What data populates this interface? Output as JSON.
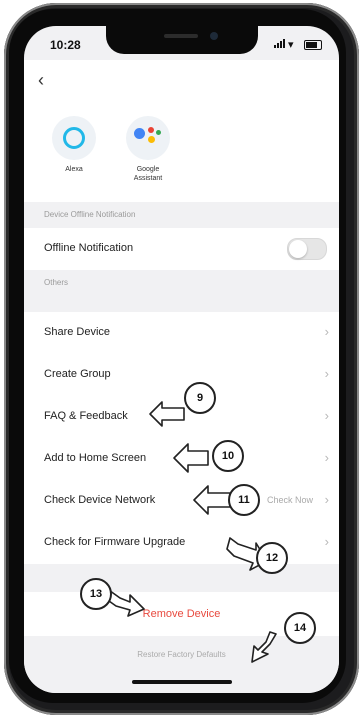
{
  "status": {
    "time": "10:28"
  },
  "nav": {
    "back_icon": "chevron-left-icon"
  },
  "assistants": [
    {
      "label": "Alexa",
      "icon": "alexa-icon",
      "color": "#21b8e8"
    },
    {
      "label": "Google\nAssistant",
      "icon": "google-assistant-icon",
      "colors": [
        "#4285f4",
        "#ea4335",
        "#fbbc05",
        "#34a853"
      ]
    }
  ],
  "sections": {
    "offline": "Device Offline Notification",
    "others": "Others"
  },
  "offline_row": {
    "label": "Offline Notification",
    "enabled": false
  },
  "others_rows": [
    {
      "label": "Share Device"
    },
    {
      "label": "Create Group"
    },
    {
      "label": "FAQ & Feedback"
    },
    {
      "label": "Add to Home Screen"
    },
    {
      "label": "Check Device Network",
      "value": "Check Now"
    },
    {
      "label": "Check for Firmware Upgrade"
    }
  ],
  "remove_device": {
    "label": "Remove Device",
    "color": "#e84a3f"
  },
  "restore": {
    "label": "Restore Factory Defaults"
  },
  "callouts": [
    "9",
    "10",
    "11",
    "12",
    "13",
    "14"
  ]
}
